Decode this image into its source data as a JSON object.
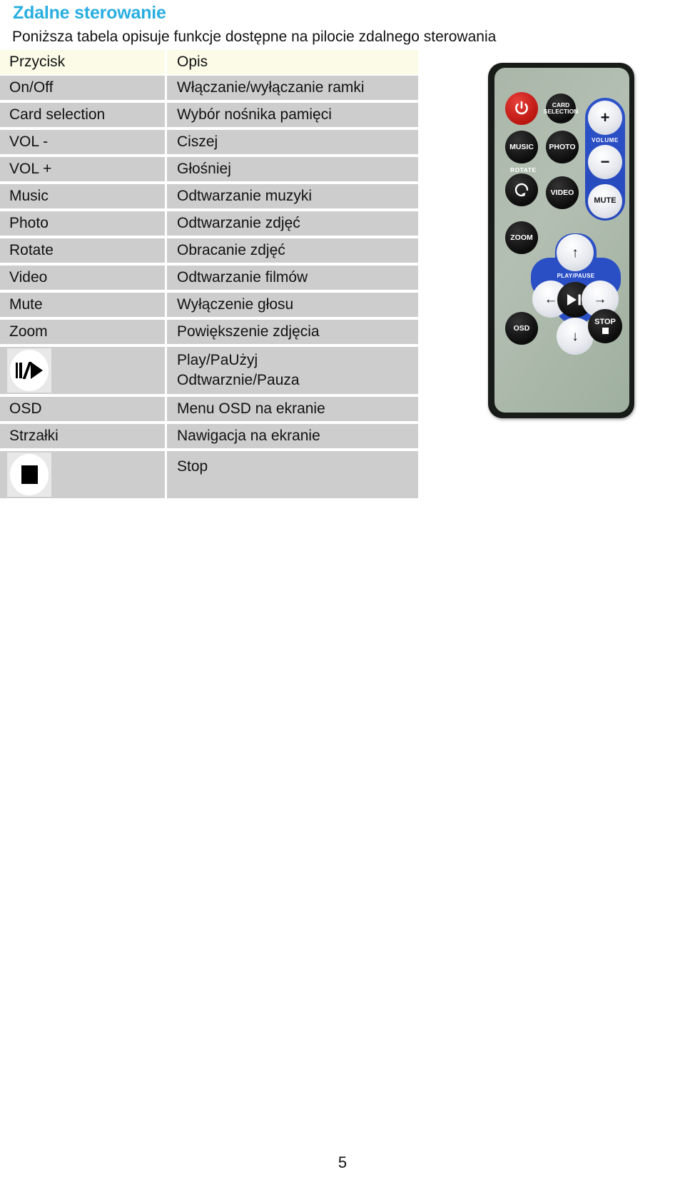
{
  "document": {
    "title": "Zdalne sterowanie",
    "intro": "Poniższa tabela opisuje funkcje dostępne na pilocie zdalnego sterowania",
    "page_number": "5",
    "title_color": "#29aee0",
    "row_bg_color": "#cdcdcd",
    "header_bg_color": "#fbfbe8"
  },
  "table": {
    "headers": {
      "button": "Przycisk",
      "description": "Opis"
    },
    "rows": [
      {
        "button": "On/Off",
        "icon": null,
        "desc": [
          "Włączanie/wyłączanie ramki"
        ]
      },
      {
        "button": "Card selection",
        "icon": null,
        "desc": [
          "Wybór nośnika pamięci"
        ]
      },
      {
        "button": "VOL -",
        "icon": null,
        "desc": [
          "Ciszej"
        ]
      },
      {
        "button": "VOL +",
        "icon": null,
        "desc": [
          "Głośniej"
        ]
      },
      {
        "button": "Music",
        "icon": null,
        "desc": [
          "Odtwarzanie muzyki"
        ]
      },
      {
        "button": "Photo",
        "icon": null,
        "desc": [
          "Odtwarzanie zdjęć"
        ]
      },
      {
        "button": "Rotate",
        "icon": null,
        "desc": [
          "Obracanie zdjęć"
        ]
      },
      {
        "button": "Video",
        "icon": null,
        "desc": [
          "Odtwarzanie filmów"
        ]
      },
      {
        "button": "Mute",
        "icon": null,
        "desc": [
          "Wyłączenie głosu"
        ]
      },
      {
        "button": "Zoom",
        "icon": null,
        "desc": [
          "Powiększenie zdjęcia"
        ]
      },
      {
        "button": "",
        "icon": "play-pause-icon",
        "desc": [
          "Play/PaUżyj",
          "Odtwarznie/Pauza"
        ]
      },
      {
        "button": "OSD",
        "icon": null,
        "desc": [
          "Menu OSD na ekranie"
        ]
      },
      {
        "button": "Strzałki",
        "icon": null,
        "desc": [
          "Nawigacja na ekranie"
        ]
      },
      {
        "button": "",
        "icon": "stop-icon",
        "desc": [
          "Stop"
        ]
      }
    ]
  },
  "remote": {
    "body_color": "#a9b6a8",
    "bezel_color": "#181c18",
    "accent_blue": "#2a4fc5",
    "power_color": "#b9130e",
    "buttons": {
      "power": "",
      "card_selection_line1": "CARD",
      "card_selection_line2": "SELECTION",
      "volume_plus": "+",
      "volume_label": "VOLUME",
      "volume_minus": "−",
      "music": "MUSIC",
      "photo": "PHOTO",
      "rotate_label": "ROTATE",
      "rotate_glyph": "↻",
      "video": "VIDEO",
      "mute": "MUTE",
      "zoom": "ZOOM",
      "up": "↑",
      "left": "←",
      "right": "→",
      "down": "↓",
      "play_pause_label": "PLAY/PAUSE",
      "play_pause_glyph": "▶❙❙",
      "osd": "OSD",
      "stop": "STOP"
    }
  }
}
